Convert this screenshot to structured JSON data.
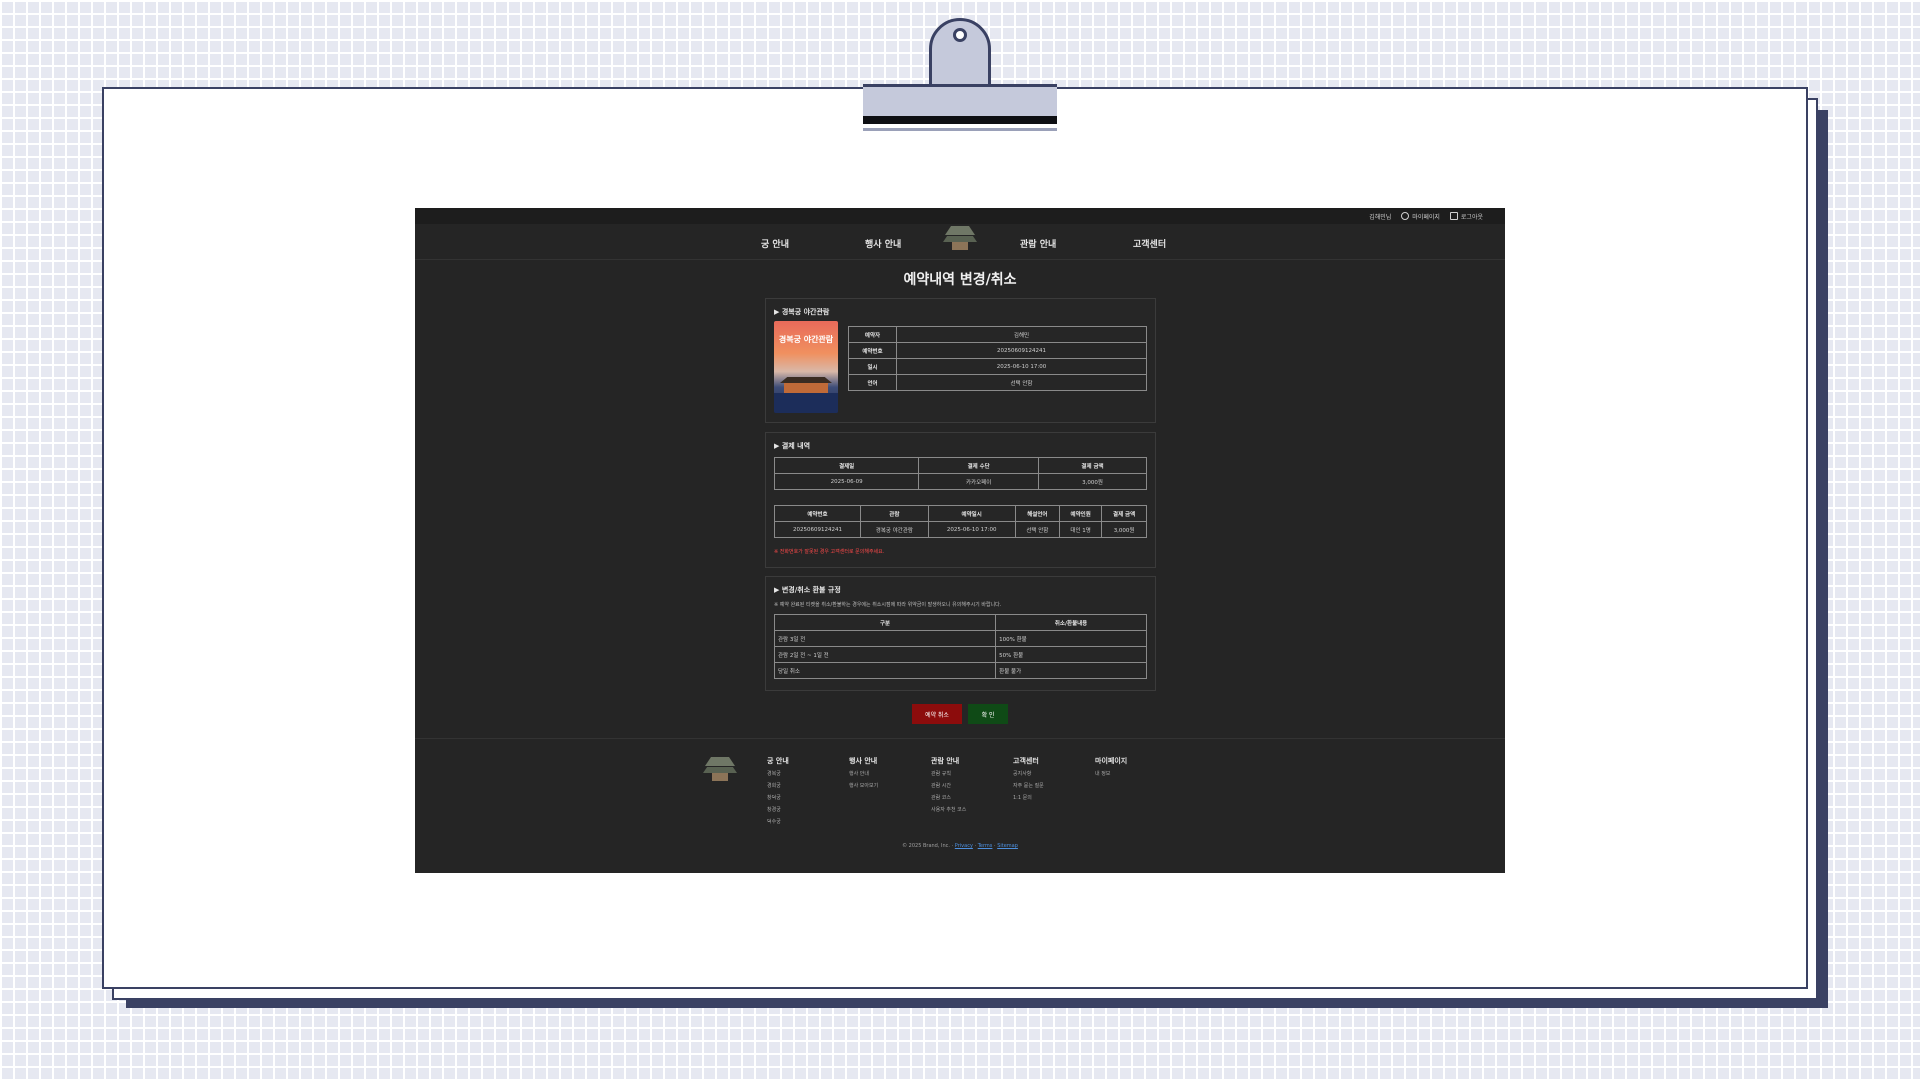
{
  "topbar": {
    "user": "김해민님",
    "mypage": "마이페이지",
    "logout": "로그아웃"
  },
  "nav": {
    "item1": "궁 안내",
    "item2": "행사 안내",
    "item3": "관람 안내",
    "item4": "고객센터"
  },
  "page_title": "예약내역 변경/취소",
  "reservation": {
    "section_title": "▶ 경복궁 야간관람",
    "poster_title": "경복궁 야간관람",
    "rows": [
      {
        "label": "예약자",
        "value": "김해민"
      },
      {
        "label": "예약번호",
        "value": "20250609124241"
      },
      {
        "label": "일시",
        "value": "2025-06-10 17:00"
      },
      {
        "label": "언어",
        "value": "선택 안함"
      }
    ]
  },
  "payment": {
    "section_title": "▶ 결제 내역",
    "headers": [
      "결제일",
      "결제 수단",
      "결제 금액"
    ],
    "row": [
      "2025-06-09",
      "카카오페이",
      "3,000원"
    ],
    "detail_headers": [
      "예약번호",
      "관람",
      "예약일시",
      "해설언어",
      "예약인원",
      "결제 금액"
    ],
    "detail_row": [
      "20250609124241",
      "경복궁 야간관람",
      "2025-06-10 17:00",
      "선택 안함",
      "대인 1명",
      "3,000원"
    ],
    "notice": "※ 전화번호가 잘못된 경우 고객센터로 문의해주세요."
  },
  "policy": {
    "section_title": "▶ 변경/취소 환불 규정",
    "note": "※ 예약 완료된 티켓을 취소/환불하는 경우에는 취소시점에 따라 위약금이 발생하오니 유의해주시기 바랍니다.",
    "headers": [
      "구분",
      "취소/환불내용"
    ],
    "rows": [
      [
        "관람 3일 전",
        "100% 환불"
      ],
      [
        "관람 2일 전 ~ 1일 전",
        "50% 환불"
      ],
      [
        "당일 취소",
        "환불 불가"
      ]
    ]
  },
  "buttons": {
    "cancel": "예약 취소",
    "confirm": "확 인"
  },
  "footer": {
    "columns": [
      {
        "title": "궁 안내",
        "links": [
          "경복궁",
          "경희궁",
          "창덕궁",
          "창경궁",
          "덕수궁"
        ]
      },
      {
        "title": "행사 안내",
        "links": [
          "행사 안내",
          "행사 모아보기"
        ]
      },
      {
        "title": "관람 안내",
        "links": [
          "관람 규칙",
          "관람 시간",
          "관람 코스",
          "사용자 추천 코스"
        ]
      },
      {
        "title": "고객센터",
        "links": [
          "공지사항",
          "자주 묻는 질문",
          "1:1 문의"
        ]
      },
      {
        "title": "마이페이지",
        "links": [
          "내 정보"
        ]
      }
    ],
    "copyright": "© 2025 Brand, Inc. ·",
    "privacy": "Privacy",
    "terms": "Terms",
    "sitemap": "Sitemap",
    "sep": "·"
  }
}
